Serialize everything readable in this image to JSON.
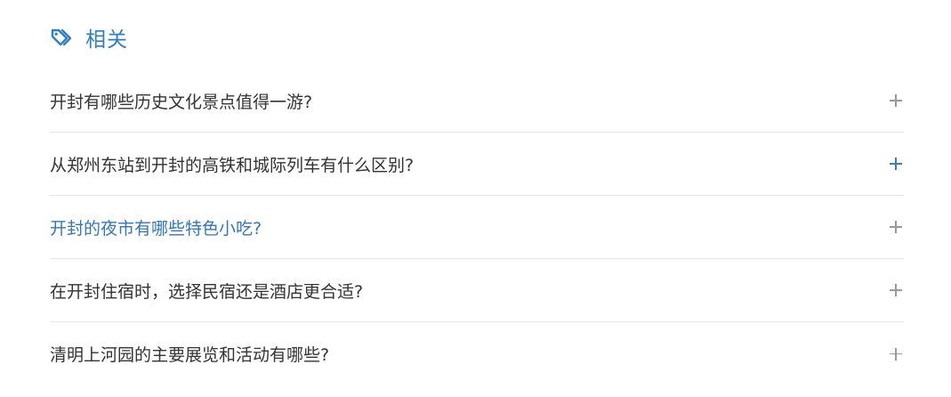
{
  "header": {
    "icon": "tags-icon",
    "title": "相关",
    "accent_color": "#2f7fc4"
  },
  "questions": [
    {
      "text": "开封有哪些历史文化景点值得一游?",
      "active": false
    },
    {
      "text": "从郑州东站到开封的高铁和城际列车有什么区别?",
      "active": false
    },
    {
      "text": "开封的夜市有哪些特色小吃?",
      "active": true
    },
    {
      "text": "在开封住宿时，选择民宿还是酒店更合适?",
      "active": false
    },
    {
      "text": "清明上河园的主要展览和活动有哪些?",
      "active": false
    }
  ],
  "colors": {
    "text": "#333333",
    "active_text": "#3377b8",
    "divider": "#e6e6e6",
    "plus_icon": "#9a9a9a",
    "plus_icon_highlight": "#3a7fc0"
  },
  "expand_icon": "plus-icon"
}
